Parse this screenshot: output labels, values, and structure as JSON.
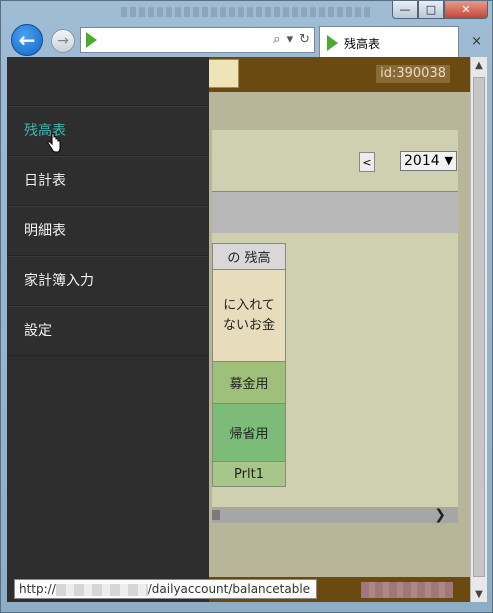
{
  "browser": {
    "address_text": "",
    "tab_title": "残高表",
    "tab_close": "×",
    "window_buttons": {
      "minimize": "—",
      "maximize": "□",
      "close": "✕"
    },
    "icons": [
      "back-arrow-icon",
      "forward-arrow-icon",
      "play-icon",
      "search-icon",
      "refresh-icon"
    ]
  },
  "page": {
    "user_id": "id:390038",
    "prev_button": "<",
    "year_select": "2014",
    "table": {
      "header": "の 残高",
      "note": "に入れてないお金",
      "row_a": "募金用",
      "row_b": "帰省用",
      "row_c": "Prlt1"
    }
  },
  "drawer": {
    "items": [
      {
        "label": "残高表",
        "active": true
      },
      {
        "label": "日計表",
        "active": false
      },
      {
        "label": "明細表",
        "active": false
      },
      {
        "label": "家計簿入力",
        "active": false
      },
      {
        "label": "設定",
        "active": false
      }
    ]
  },
  "status": {
    "url_prefix": "http://",
    "url_suffix": "/dailyaccount/balancetable"
  },
  "colors": {
    "accent": "#3fb6ad",
    "header_brown": "#6b4a12",
    "drawer_bg": "#2e2e2e"
  }
}
